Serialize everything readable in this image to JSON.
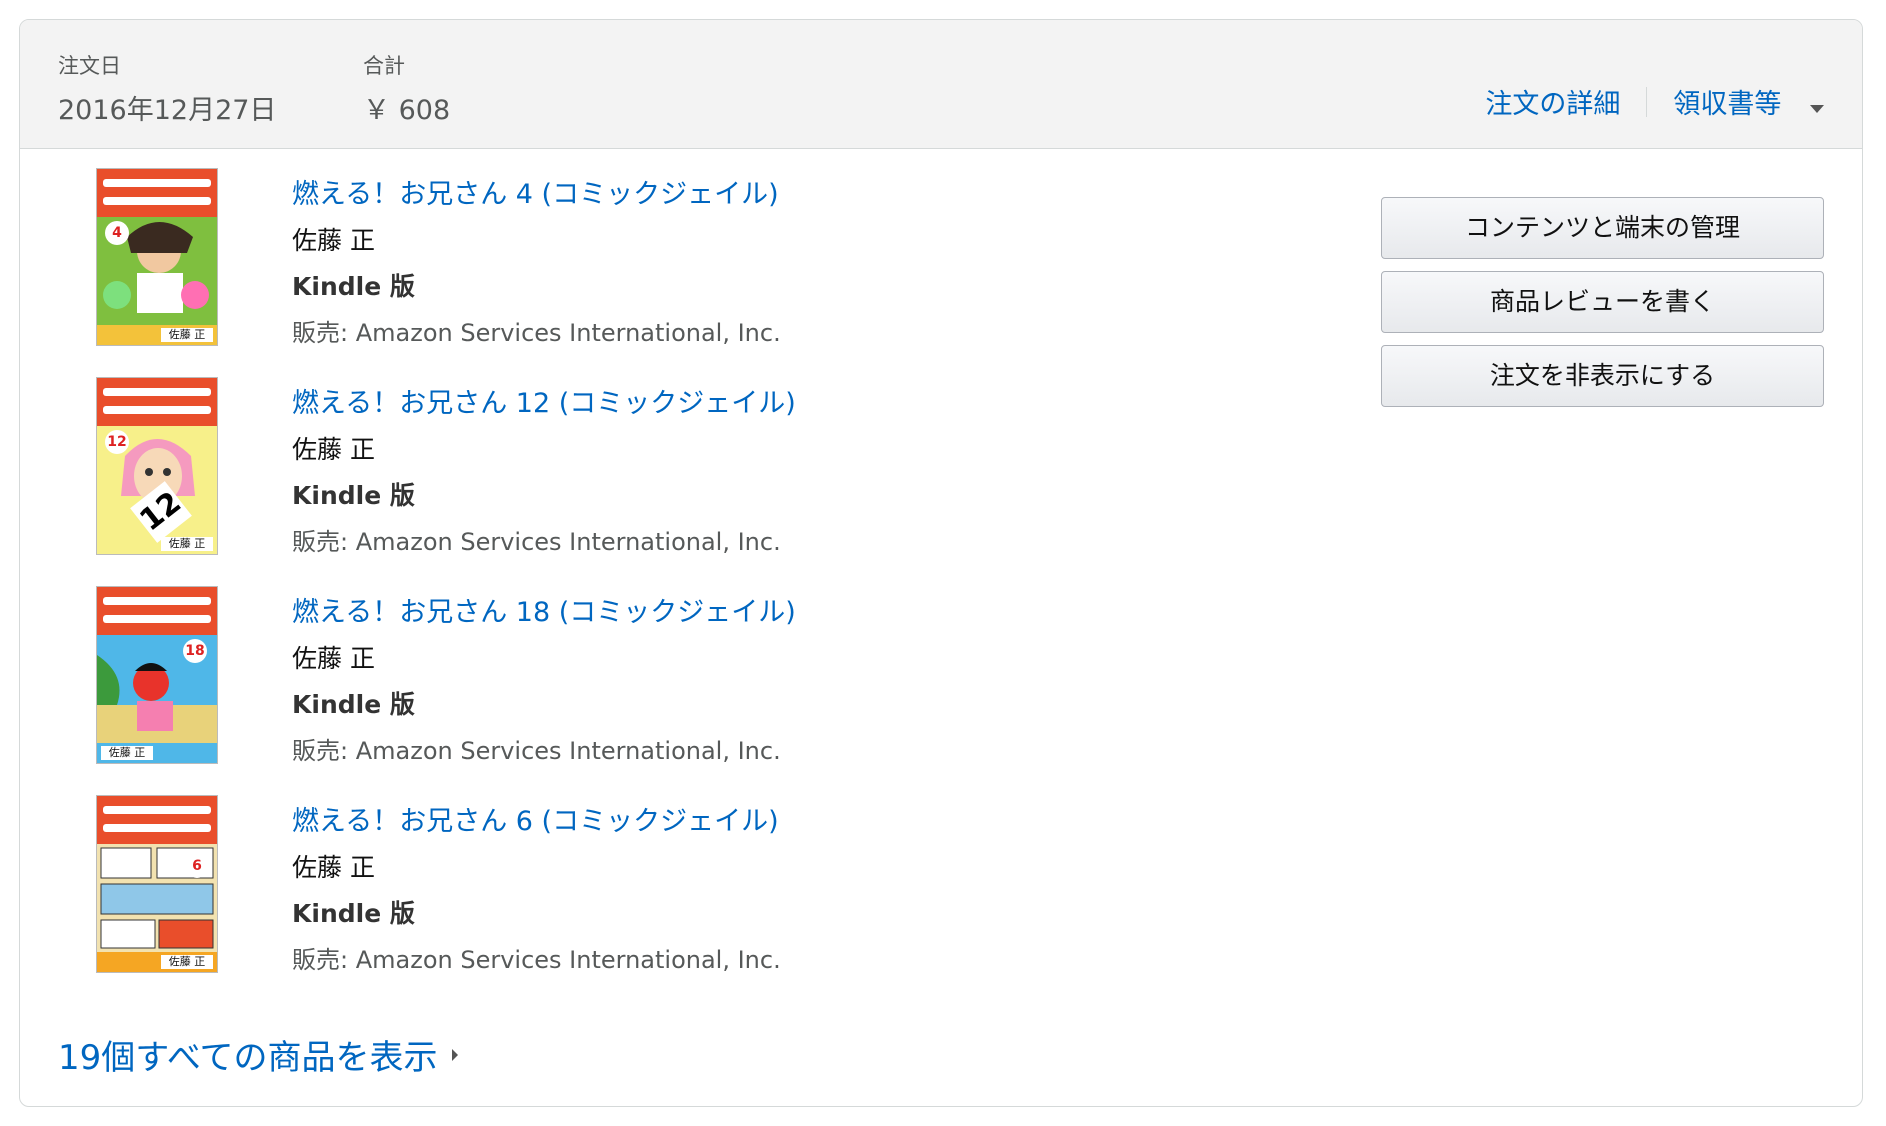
{
  "header": {
    "order_date_label": "注文日",
    "order_date_value": "2016年12月27日",
    "total_label": "合計",
    "total_value": "￥ 608",
    "details_link": "注文の詳細",
    "receipt_link": "領収書等"
  },
  "items": [
    {
      "title": "燃える！お兄さん 4 (コミックジェイル)",
      "author": "佐藤 正",
      "format": "Kindle 版",
      "seller": "販売: Amazon Services International, Inc.",
      "cover_volume": "4",
      "cover_author": "佐藤 正"
    },
    {
      "title": "燃える！お兄さん 12 (コミックジェイル)",
      "author": "佐藤 正",
      "format": "Kindle 版",
      "seller": "販売: Amazon Services International, Inc.",
      "cover_volume": "12",
      "cover_author": "佐藤 正"
    },
    {
      "title": "燃える！お兄さん 18 (コミックジェイル)",
      "author": "佐藤 正",
      "format": "Kindle 版",
      "seller": "販売: Amazon Services International, Inc.",
      "cover_volume": "18",
      "cover_author": "佐藤 正"
    },
    {
      "title": "燃える！お兄さん 6 (コミックジェイル)",
      "author": "佐藤 正",
      "format": "Kindle 版",
      "seller": "販売: Amazon Services International, Inc.",
      "cover_volume": "6",
      "cover_author": "佐藤 正"
    }
  ],
  "actions": {
    "manage_content": "コンテンツと端末の管理",
    "write_review": "商品レビューを書く",
    "hide_order": "注文を非表示にする"
  },
  "show_all": "19個すべての商品を表示",
  "colors": {
    "link": "#0066c0",
    "header_bg": "#f3f3f3",
    "border": "#d5d9d9"
  }
}
